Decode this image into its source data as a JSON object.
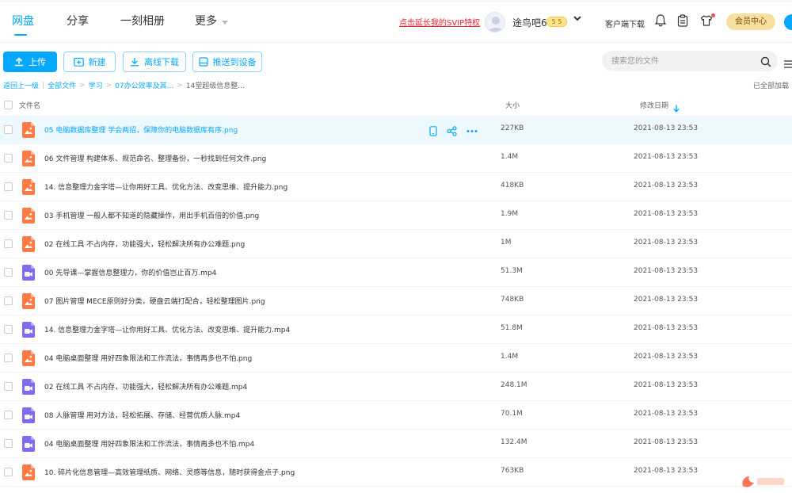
{
  "nav": {
    "tabs": [
      {
        "label": "网盘"
      },
      {
        "label": "分享"
      },
      {
        "label": "一刻相册"
      },
      {
        "label": "更多"
      }
    ]
  },
  "header": {
    "svip_link": "点击延长我的SVIP特权",
    "username": "途鸟吧6",
    "level_badge": "5 5",
    "client_download": "客户端下载",
    "vip_center": "会员中心"
  },
  "toolbar": {
    "upload": "上传",
    "new": "新建",
    "offline": "离线下载",
    "push": "推送到设备"
  },
  "search": {
    "placeholder": "搜索您的文件"
  },
  "breadcrumb": {
    "back": "返回上一级",
    "items": [
      "全部文件",
      "学习",
      "07办公效率及其..."
    ],
    "current": "14堂超级信息整...",
    "loaded_all": "已全部加载"
  },
  "table": {
    "headers": {
      "name": "文件名",
      "size": "大小",
      "date": "修改日期"
    },
    "rows": [
      {
        "name": "05 电脑数据库整理 学会两招，保障你的电脑数据库有序.png",
        "size": "227KB",
        "date": "2021-08-13 23:53",
        "type": "image"
      },
      {
        "name": "06 文件管理 构建体系、规范命名、整理备份，一秒找到任何文件.png",
        "size": "1.4M",
        "date": "2021-08-13 23:53",
        "type": "image"
      },
      {
        "name": "14. 信息整理力金字塔—让你用好工具、优化方法、改变思维、提升能力.png",
        "size": "418KB",
        "date": "2021-08-13 23:53",
        "type": "image"
      },
      {
        "name": "03 手机管理 一般人都不知道的隐藏操作，用出手机百倍的价值.png",
        "size": "1.9M",
        "date": "2021-08-13 23:53",
        "type": "image"
      },
      {
        "name": "02 在线工具 不占内存，功能强大，轻松解决所有办公难题.png",
        "size": "1M",
        "date": "2021-08-13 23:53",
        "type": "image"
      },
      {
        "name": "00 先导课—掌握信息整理力，你的价值岂止百万.mp4",
        "size": "51.3M",
        "date": "2021-08-13 23:53",
        "type": "video"
      },
      {
        "name": "07 图片管理 MECE原则好分类，硬盘云端打配合，轻松整理图片.png",
        "size": "748KB",
        "date": "2021-08-13 23:53",
        "type": "image"
      },
      {
        "name": "14. 信息整理力金字塔—让你用好工具、优化方法、改变思维、提升能力.mp4",
        "size": "51.8M",
        "date": "2021-08-13 23:53",
        "type": "video"
      },
      {
        "name": "04 电脑桌面整理 用好四象限法和工作流法，事情再多也不怕.png",
        "size": "1.4M",
        "date": "2021-08-13 23:53",
        "type": "image"
      },
      {
        "name": "02 在线工具 不占内存，功能强大，轻松解决所有办公难题.mp4",
        "size": "248.1M",
        "date": "2021-08-13 23:53",
        "type": "video"
      },
      {
        "name": "08 人脉管理 用对方法，轻松拓展、存储、经营优质人脉.mp4",
        "size": "70.1M",
        "date": "2021-08-13 23:53",
        "type": "video"
      },
      {
        "name": "04 电脑桌面整理 用好四象限法和工作流法，事情再多也不怕.mp4",
        "size": "132.4M",
        "date": "2021-08-13 23:53",
        "type": "video"
      },
      {
        "name": "10. 碎片化信息管理—高效管理纸质、网络、灵感等信息，随时获得金点子.png",
        "size": "763KB",
        "date": "2021-08-13 23:53",
        "type": "image"
      }
    ]
  },
  "colors": {
    "accent": "#06a7ff",
    "image_icon": "#ff7a45",
    "video_icon": "#7d6cf0",
    "hover_row": "#eef8ff",
    "svip_link": "#f5222d"
  }
}
